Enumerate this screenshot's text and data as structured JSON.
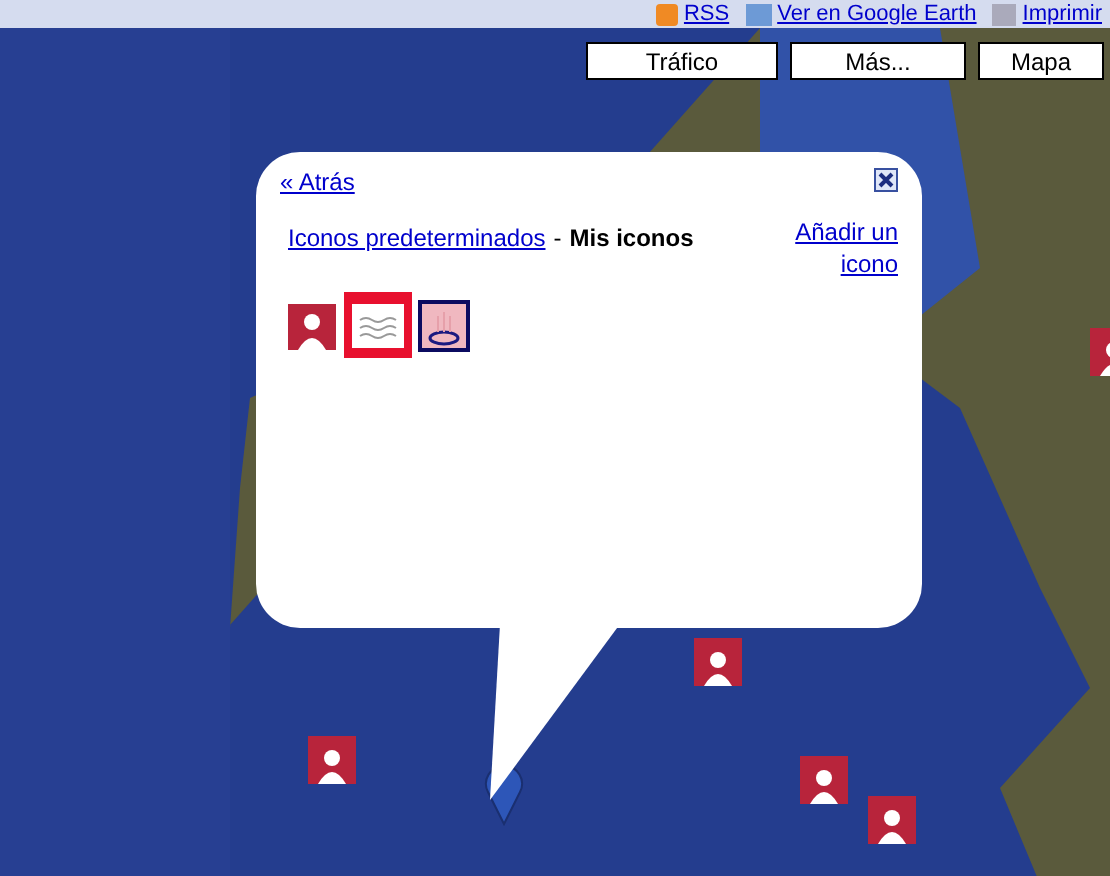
{
  "top_links": [
    {
      "label": "RSS",
      "kind": "rss"
    },
    {
      "label": "Ver en Google Earth",
      "kind": "earth"
    },
    {
      "label": "Imprimir",
      "kind": "print"
    }
  ],
  "map_buttons": [
    {
      "label": "Tráfico",
      "selected": false
    },
    {
      "label": "Más...",
      "selected": false
    },
    {
      "label": "Mapa",
      "selected": false
    }
  ],
  "popup": {
    "back_link": "« Atrás",
    "tabs": [
      {
        "label": "Iconos predeterminados",
        "selected": false
      },
      {
        "label": "Mis iconos",
        "selected": true
      }
    ],
    "separator": "-",
    "add_link": "Añadir un icono",
    "icons": [
      {
        "kind": "person",
        "selected": false
      },
      {
        "kind": "water",
        "selected": true
      },
      {
        "kind": "steam",
        "selected": false
      }
    ]
  }
}
